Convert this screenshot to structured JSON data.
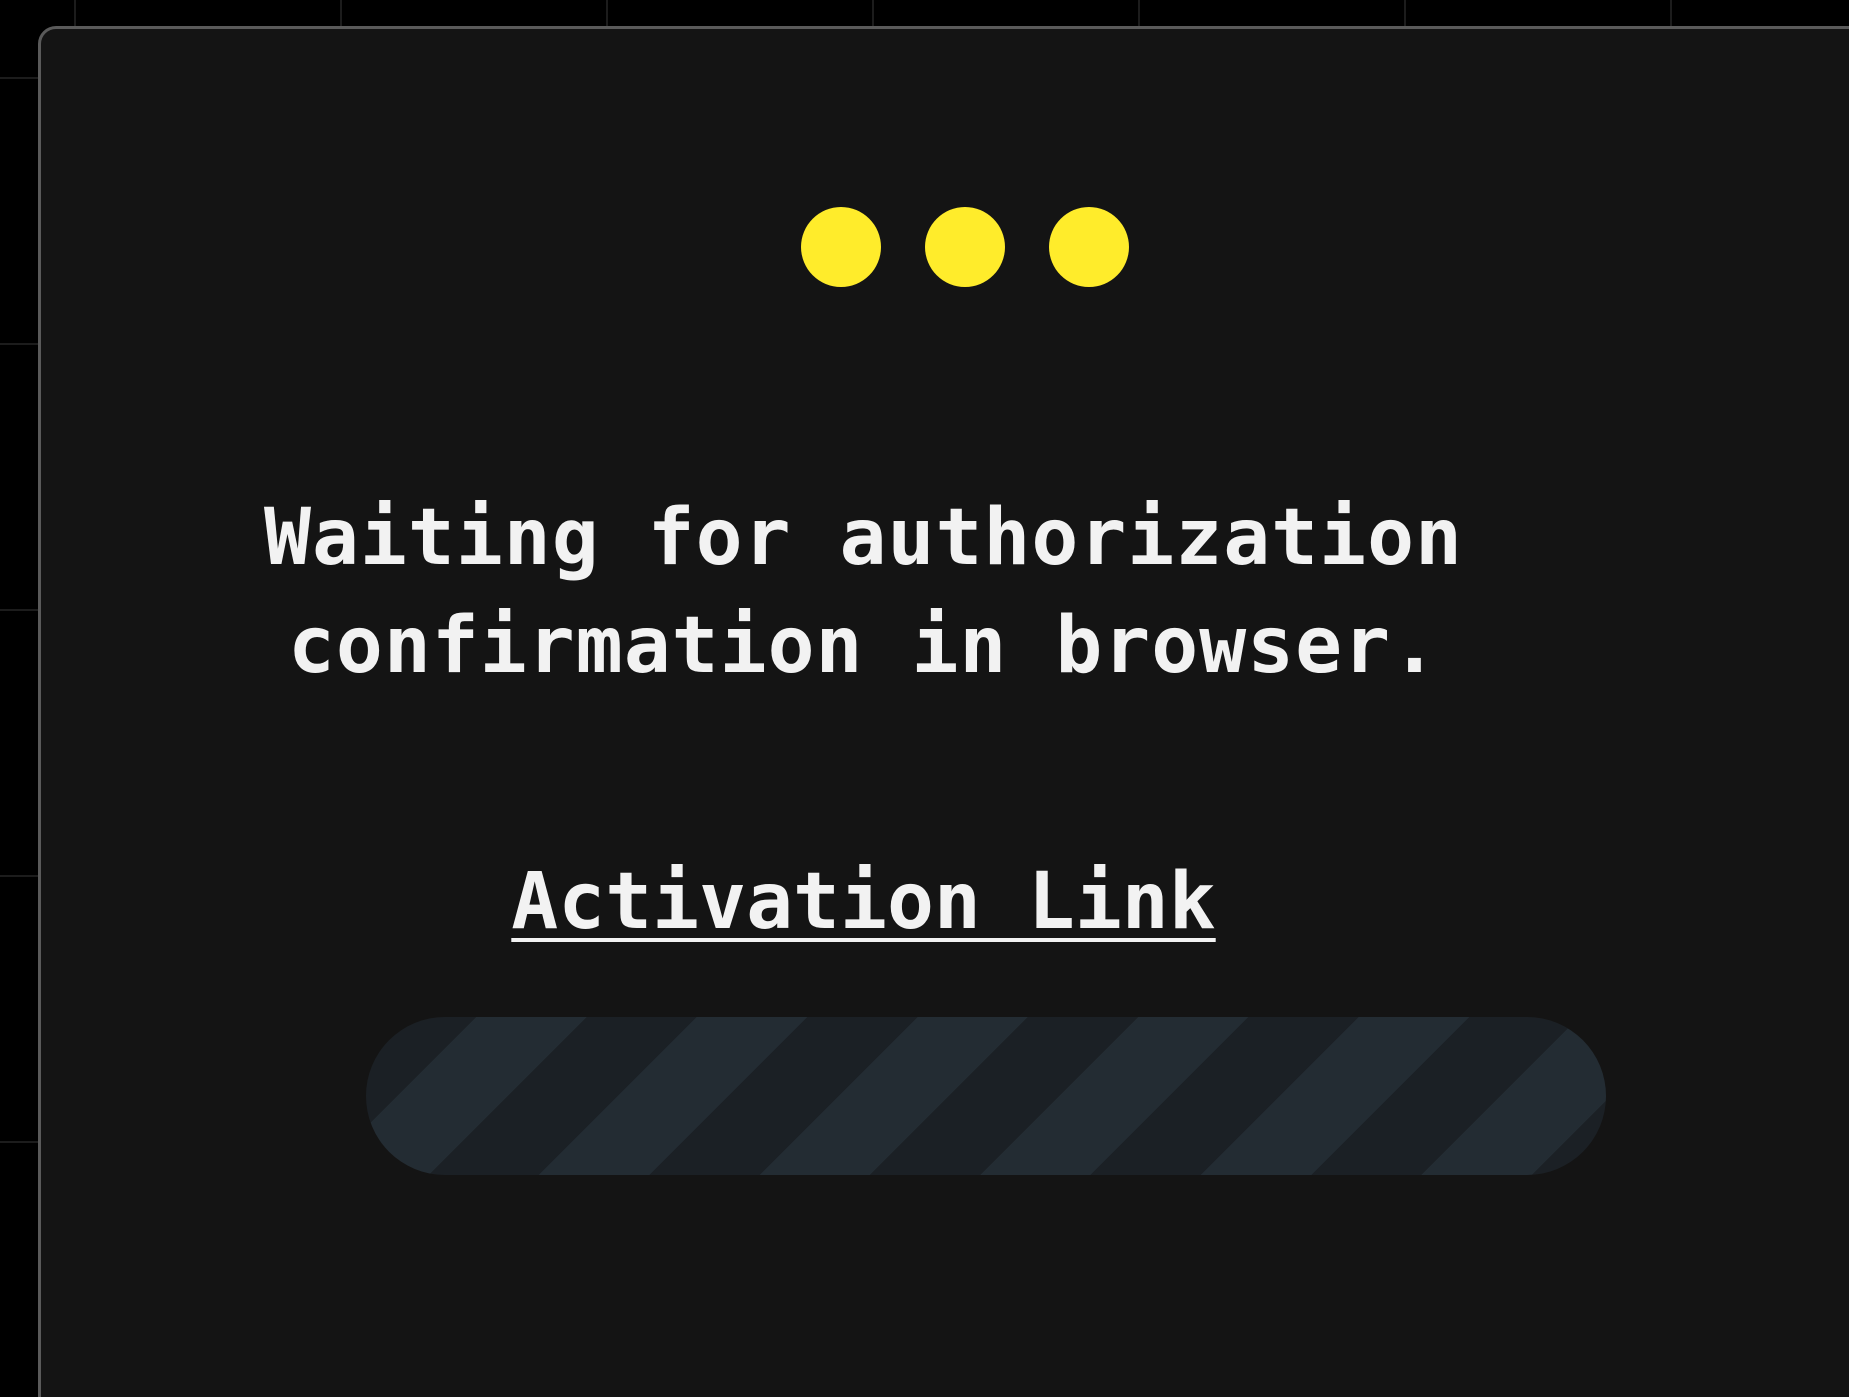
{
  "dialog": {
    "loading_indicator": "three-dot-loader",
    "accent_color": "#ffec2b",
    "message": "Waiting for authorization confirmation in browser.",
    "link_label": "Activation Link",
    "progress": {
      "state": "indeterminate",
      "stripe_colors": [
        "#1b2025",
        "#232c33"
      ]
    }
  }
}
